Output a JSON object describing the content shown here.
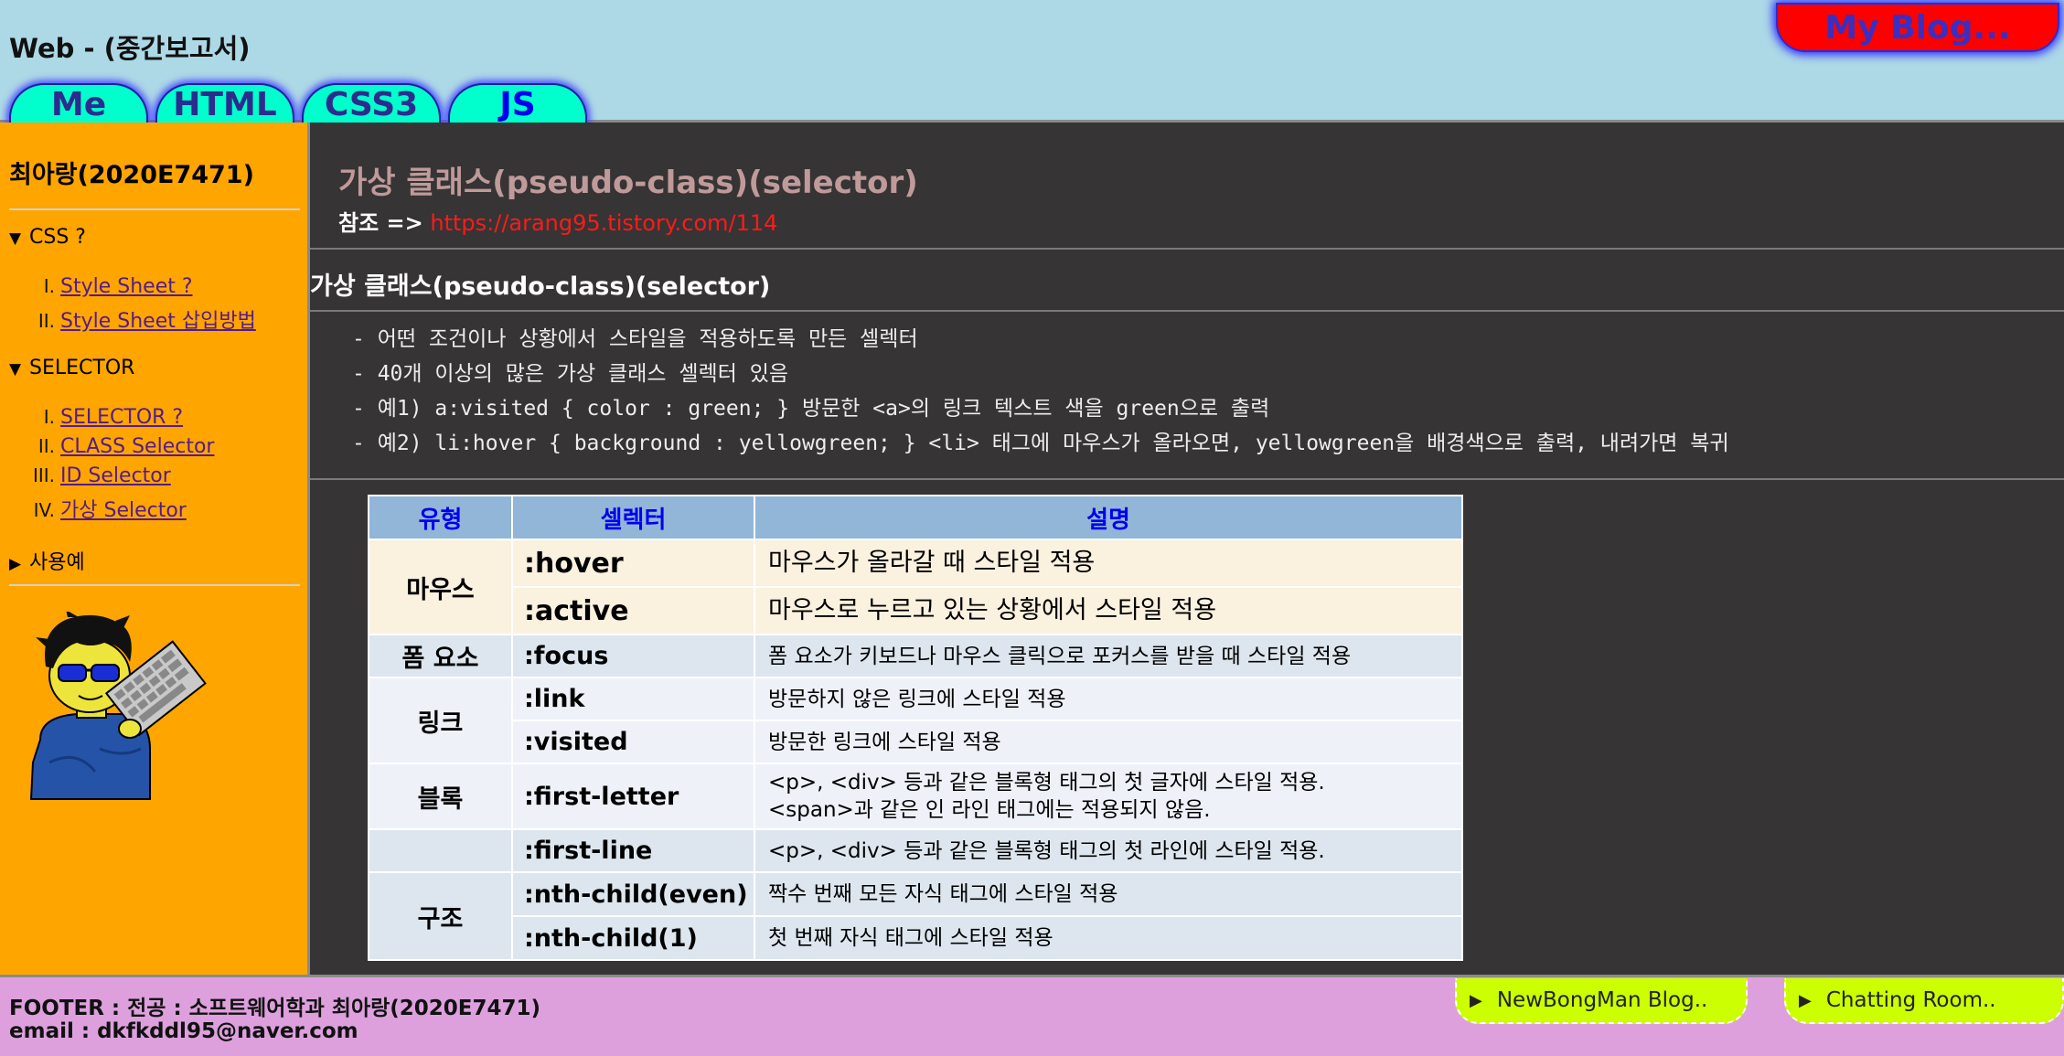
{
  "header": {
    "site_title": "Web - (중간보고서)",
    "blog_button": "My Blog...",
    "tabs": [
      "Me",
      "HTML",
      "CSS3",
      "JS"
    ]
  },
  "sidebar": {
    "name": "최아랑(2020E7471)",
    "groups": [
      {
        "label": "CSS ?",
        "open": true,
        "items": [
          {
            "num": "I.",
            "label": "Style Sheet ?"
          },
          {
            "num": "II.",
            "label": "Style Sheet 삽입방법"
          }
        ]
      },
      {
        "label": "SELECTOR",
        "open": true,
        "items": [
          {
            "num": "I.",
            "label": "SELECTOR ?"
          },
          {
            "num": "II.",
            "label": "CLASS Selector"
          },
          {
            "num": "III.",
            "label": "ID Selector"
          },
          {
            "num": "IV.",
            "label": "가상 Selector"
          }
        ]
      },
      {
        "label": "사용예",
        "open": false,
        "items": []
      }
    ]
  },
  "main": {
    "title": "가상 클래스(pseudo-class)(selector)",
    "ref_label": "참조 =>",
    "ref_url": "https://arang95.tistory.com/114",
    "section_heading": "가상 클래스(pseudo-class)(selector)",
    "description": [
      "- 어떤 조건이나 상황에서 스타일을 적용하도록 만든 셀렉터",
      "- 40개 이상의 많은 가상 클래스 셀렉터 있음",
      "- 예1) a:visited { color : green; } 방문한 <a>의 링크 텍스트 색을 green으로 출력",
      "- 예2) li:hover { background : yellowgreen; } <li> 태그에 마우스가 올라오면, yellowgreen을 배경색으로 출력, 내려가면 복귀"
    ],
    "table": {
      "headers": [
        "유형",
        "셀렉터",
        "설명"
      ],
      "groups": {
        "mouse": "마우스",
        "form": "폼 요소",
        "link": "링크",
        "block": "블록",
        "structure": "구조"
      },
      "rows": [
        {
          "selector": ":hover",
          "description": "마우스가 올라갈 때 스타일 적용"
        },
        {
          "selector": ":active",
          "description": "마우스로 누르고 있는 상황에서 스타일 적용"
        },
        {
          "selector": ":focus",
          "description": "폼 요소가 키보드나 마우스 클릭으로 포커스를 받을 때 스타일 적용"
        },
        {
          "selector": ":link",
          "description": "방문하지 않은 링크에 스타일 적용"
        },
        {
          "selector": ":visited",
          "description": "방문한 링크에 스타일 적용"
        },
        {
          "selector": ":first-letter",
          "description_1": "<p>, <div> 등과 같은 블록형 태그의 첫 글자에 스타일 적용.",
          "description_2": "<span>과 같은 인 라인 태그에는 적용되지 않음."
        },
        {
          "selector": ":first-line",
          "description": "<p>, <div> 등과 같은 블록형 태그의  첫 라인에 스타일 적용."
        },
        {
          "selector": ":nth-child(even)",
          "description": "짝수 번째 모든 자식 태그에 스타일 적용"
        },
        {
          "selector": ":nth-child(1)",
          "description": "첫 번째 자식 태그에 스타일 적용"
        }
      ]
    }
  },
  "footer": {
    "line1": "FOOTER : 전공 : 소프트웨어학과 최아랑(2020E7471)",
    "line2": "email : dkfkddl95@naver.com",
    "buttons": [
      "NewBongMan Blog..",
      "Chatting Room.."
    ]
  },
  "colors": {
    "header_bg": "#add8e6",
    "sidebar_bg": "#ffa500",
    "main_bg": "#363435",
    "footer_bg": "#dda0dd",
    "tab_bg": "#00ffcc",
    "blog_button_bg": "#ff0000",
    "footer_button_bg": "#ccff00",
    "link_red": "#ff1a1a"
  }
}
